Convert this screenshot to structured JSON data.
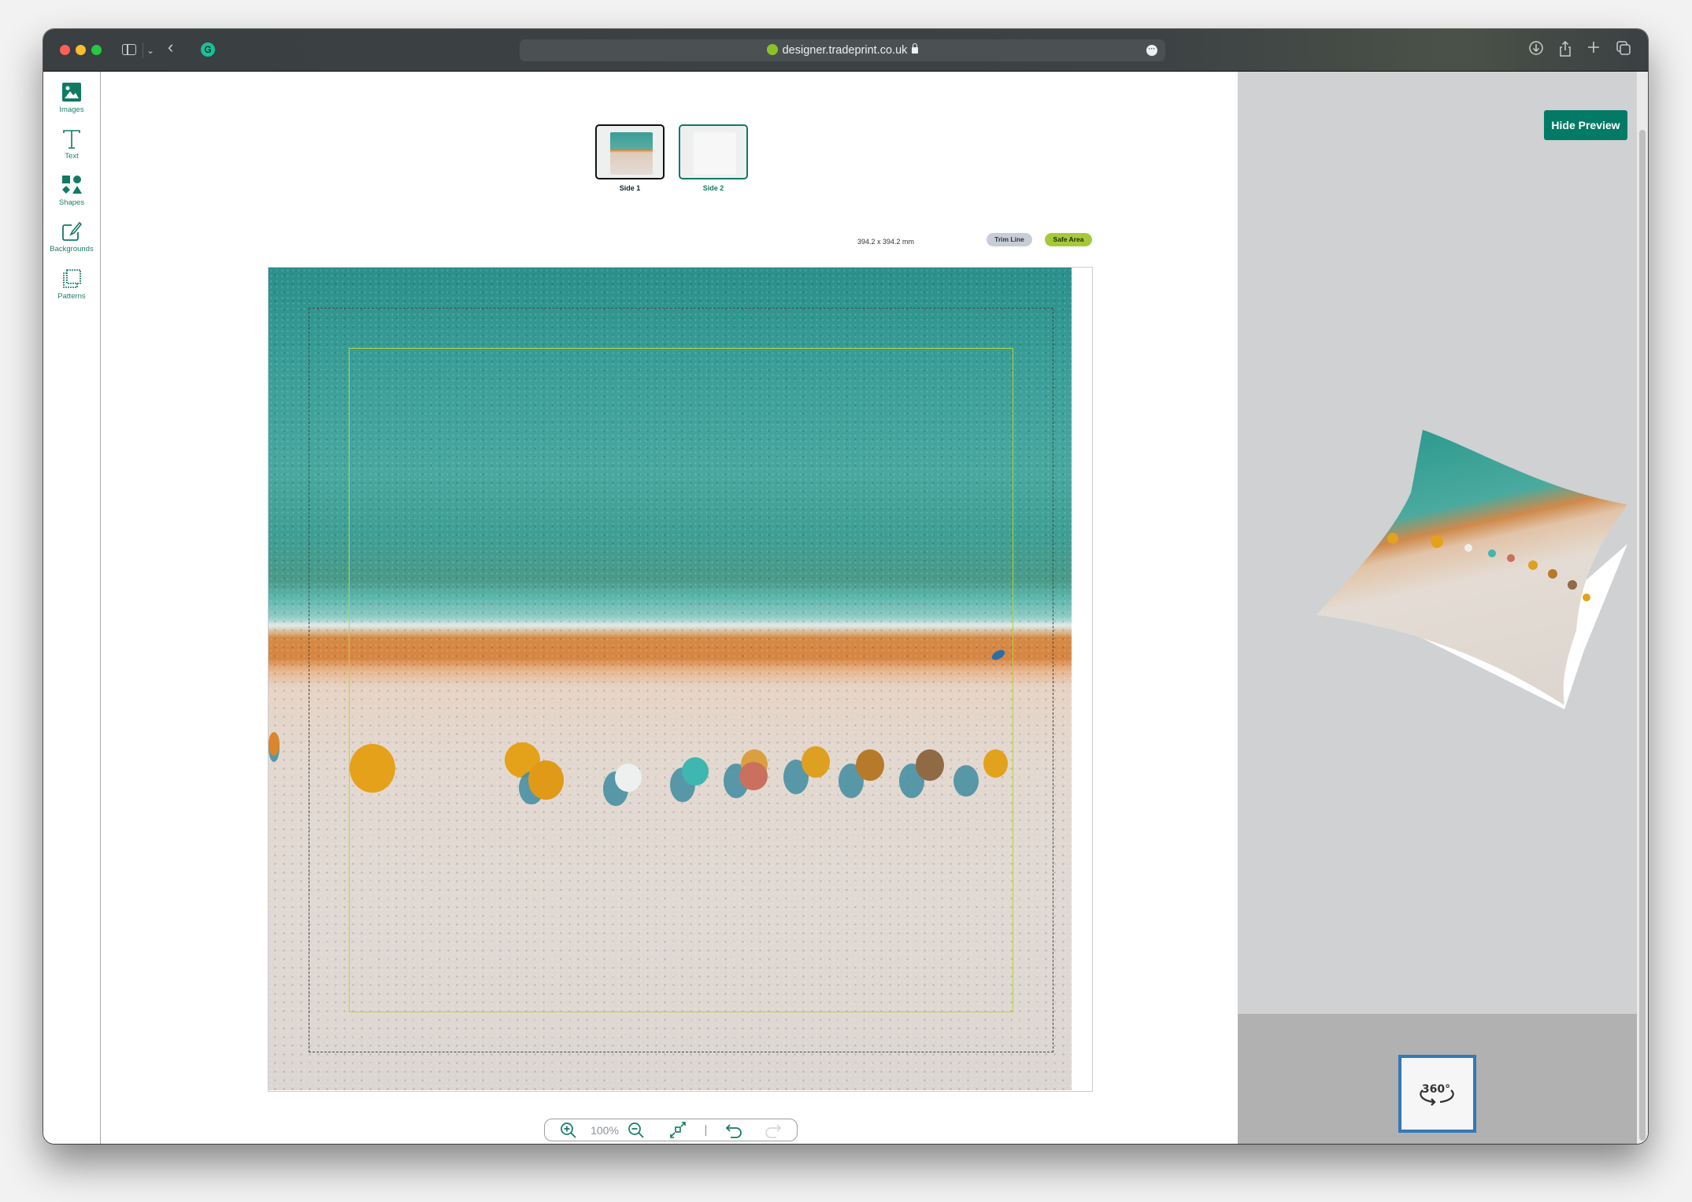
{
  "browser": {
    "url": "designer.tradeprint.co.uk",
    "secure": true,
    "icons": [
      "sidebar-toggle-icon",
      "chevron-down-icon",
      "back-icon",
      "grammarly-icon",
      "download-icon",
      "share-icon",
      "new-tab-icon",
      "tabs-overview-icon"
    ]
  },
  "toolbar": {
    "tools": [
      {
        "label": "Images",
        "icon": "image-icon"
      },
      {
        "label": "Text",
        "icon": "text-icon"
      },
      {
        "label": "Shapes",
        "icon": "shapes-icon"
      },
      {
        "label": "Backgrounds",
        "icon": "background-brush-icon"
      },
      {
        "label": "Patterns",
        "icon": "patterns-icon"
      }
    ]
  },
  "sides": [
    {
      "label": "Side 1",
      "selected": true
    },
    {
      "label": "Side 2",
      "selected": false
    }
  ],
  "canvas": {
    "dimensions": "394.2 x 394.2 mm",
    "trim_label": "Trim Line",
    "safe_label": "Safe Area",
    "image_description": "Aerial photo of a beach with turquoise sea, orange sand and a row of beach umbrellas"
  },
  "zoom_controls": {
    "zoom_in_icon": "zoom-in-icon",
    "zoom_level": "100%",
    "zoom_out_icon": "zoom-out-icon",
    "fit_icon": "expand-icon",
    "undo_icon": "undo-icon",
    "redo_icon": "redo-icon",
    "redo_enabled": false
  },
  "preview": {
    "hide_button": "Hide Preview",
    "rotate_button_label": "360°",
    "product": "Cushion"
  },
  "colors": {
    "brand": "#037a65",
    "safe_area": "#a6c93a",
    "trim_pill": "#c7cdd7",
    "rotate_border": "#3379b6"
  }
}
